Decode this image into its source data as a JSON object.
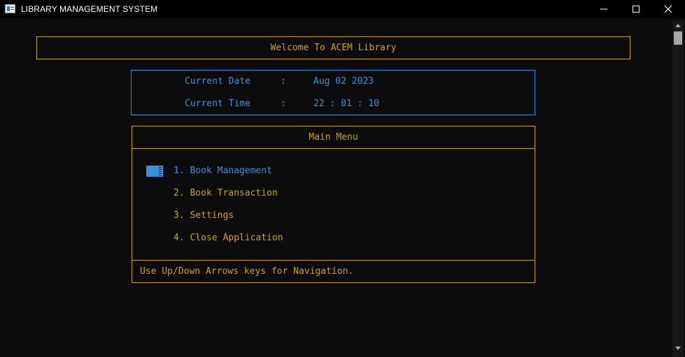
{
  "window": {
    "title": "LIBRARY MANAGEMENT SYSTEM",
    "icon": "console-app-icon",
    "controls": [
      "minimize-icon",
      "maximize-icon",
      "close-icon"
    ]
  },
  "welcome": {
    "text": "Welcome To ACEM Library"
  },
  "datetime": {
    "date_label": "Current Date",
    "date_sep": ":",
    "date_value": "Aug 02 2023",
    "time_label": "Current Time",
    "time_sep": ":",
    "time_value": "22 : 01 : 10"
  },
  "menu": {
    "title": "Main Menu",
    "items": [
      {
        "label": "1. Book Management",
        "selected": true
      },
      {
        "label": "2. Book Transaction",
        "selected": false
      },
      {
        "label": "3. Settings",
        "selected": false
      },
      {
        "label": "4. Close Application",
        "selected": false
      }
    ],
    "footer": "Use Up/Down Arrows keys for Navigation."
  },
  "colors": {
    "background": "#0c0c0c",
    "accent_gold": "#c8a11f",
    "accent_blue": "#3d8fd8",
    "titlebar": "#000000"
  }
}
